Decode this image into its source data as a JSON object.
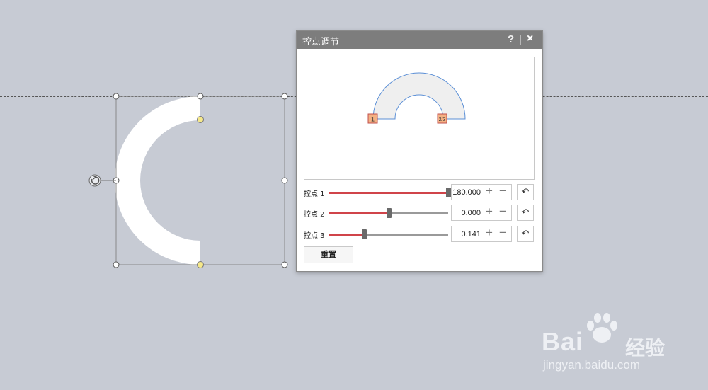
{
  "dialog": {
    "title": "控点调节",
    "help_label": "?",
    "close_label": "×",
    "preview_handles": [
      "1",
      "2/3"
    ],
    "handles": [
      {
        "label": "控点 1",
        "value": "180.000",
        "level": 1.0
      },
      {
        "label": "控点 2",
        "value": "0.000",
        "level": 0.5
      },
      {
        "label": "控点 3",
        "value": "0.141",
        "level": 0.29
      }
    ],
    "reset_all_label": "重置"
  },
  "icons": {
    "plus": "plus-icon",
    "minus": "minus-icon",
    "reset": "undo-icon",
    "rotate": "rotate-handle-icon"
  },
  "colors": {
    "accent": "#d0444a",
    "shape_fill": "#ffffff",
    "canvas_bg": "#c7cbd4",
    "adjust_handle": "#f5e88a",
    "preview_outline": "#5b8fd6",
    "handle_marker": "#f4b183"
  },
  "watermark": {
    "brand": "Bai",
    "brand_cn": "经验",
    "url": "jingyan.baidu.com"
  }
}
